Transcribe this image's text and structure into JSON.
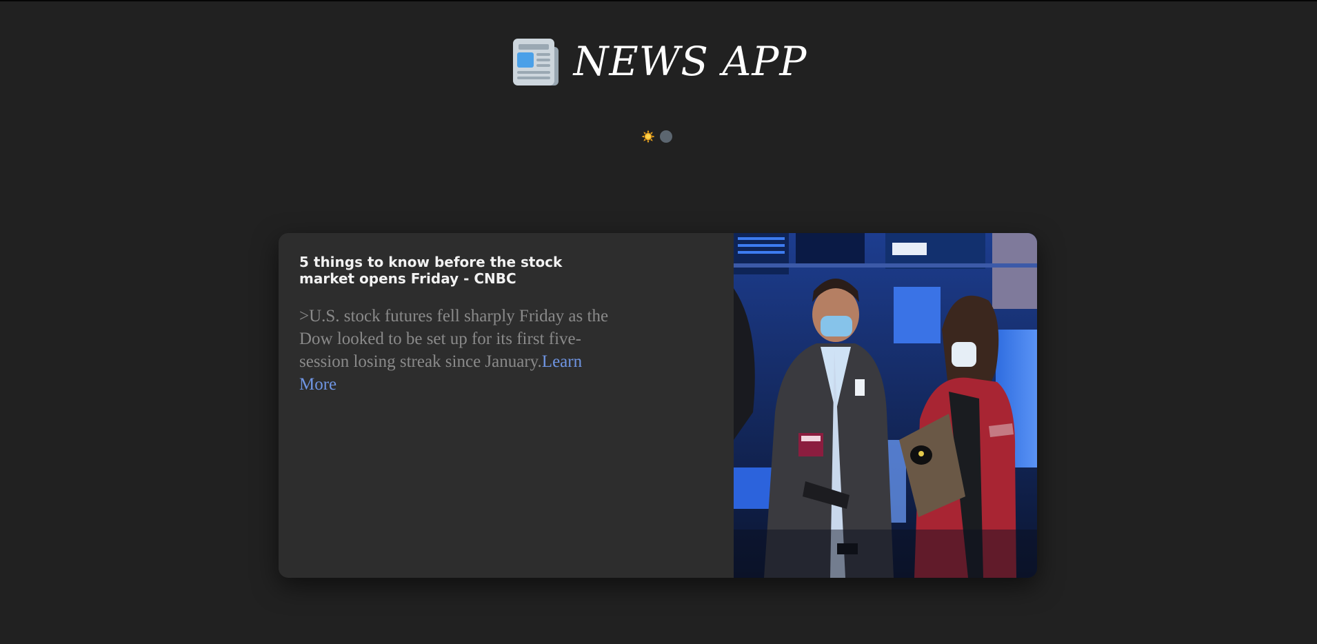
{
  "header": {
    "title": "NEWS APP",
    "logo_icon": "newspaper-icon"
  },
  "theme_toggle": {
    "icon": "sun-icon",
    "accent": "#f4a91e",
    "knob_color": "#5c6670"
  },
  "article": {
    "title": "5 things to know before the stock market opens Friday - CNBC",
    "description": "˃U.S. stock futures fell sharply Friday as the Dow looked to be set up for its first five-session losing streak since January.",
    "learn_more": "Learn More",
    "image_icon": "stock-exchange-traders-photo"
  },
  "colors": {
    "background": "#212121",
    "card": "#2d2d2d",
    "link": "#6f95e3",
    "muted_text": "#8a8a8a"
  }
}
